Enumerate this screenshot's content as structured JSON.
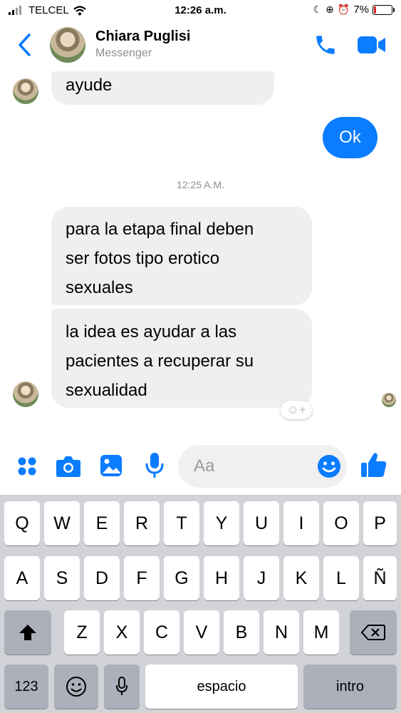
{
  "status_bar": {
    "carrier": "TELCEL",
    "time": "12:26 a.m.",
    "battery": "7%"
  },
  "header": {
    "name": "Chiara Puglisi",
    "subtitle": "Messenger"
  },
  "messages": {
    "partial_top": "ayude",
    "outgoing": "Ok",
    "timestamp": "12:25 A.M.",
    "incoming1_lines": [
      "para la etapa final deben",
      "ser fotos tipo erotico",
      "sexuales"
    ],
    "incoming2_lines": [
      "la idea es ayudar a las",
      "pacientes a recuperar su",
      "sexualidad"
    ]
  },
  "composer": {
    "placeholder": "Aa"
  },
  "keyboard": {
    "row1": [
      "Q",
      "W",
      "E",
      "R",
      "T",
      "Y",
      "U",
      "I",
      "O",
      "P"
    ],
    "row2": [
      "A",
      "S",
      "D",
      "F",
      "G",
      "H",
      "J",
      "K",
      "L",
      "Ñ"
    ],
    "row3": [
      "Z",
      "X",
      "C",
      "V",
      "B",
      "N",
      "M"
    ],
    "numbers_label": "123",
    "space_label": "espacio",
    "return_label": "intro"
  },
  "colors": {
    "accent": "#0a7cff",
    "bubble_in": "#efefef",
    "keyboard_bg": "#d1d3d8"
  },
  "icons": [
    "back-chevron-icon",
    "phone-icon",
    "video-icon",
    "grid-icon",
    "camera-icon",
    "gallery-icon",
    "microphone-icon",
    "emoji-icon",
    "thumbs-up-icon",
    "shift-icon",
    "delete-icon",
    "reaction-add-icon"
  ]
}
